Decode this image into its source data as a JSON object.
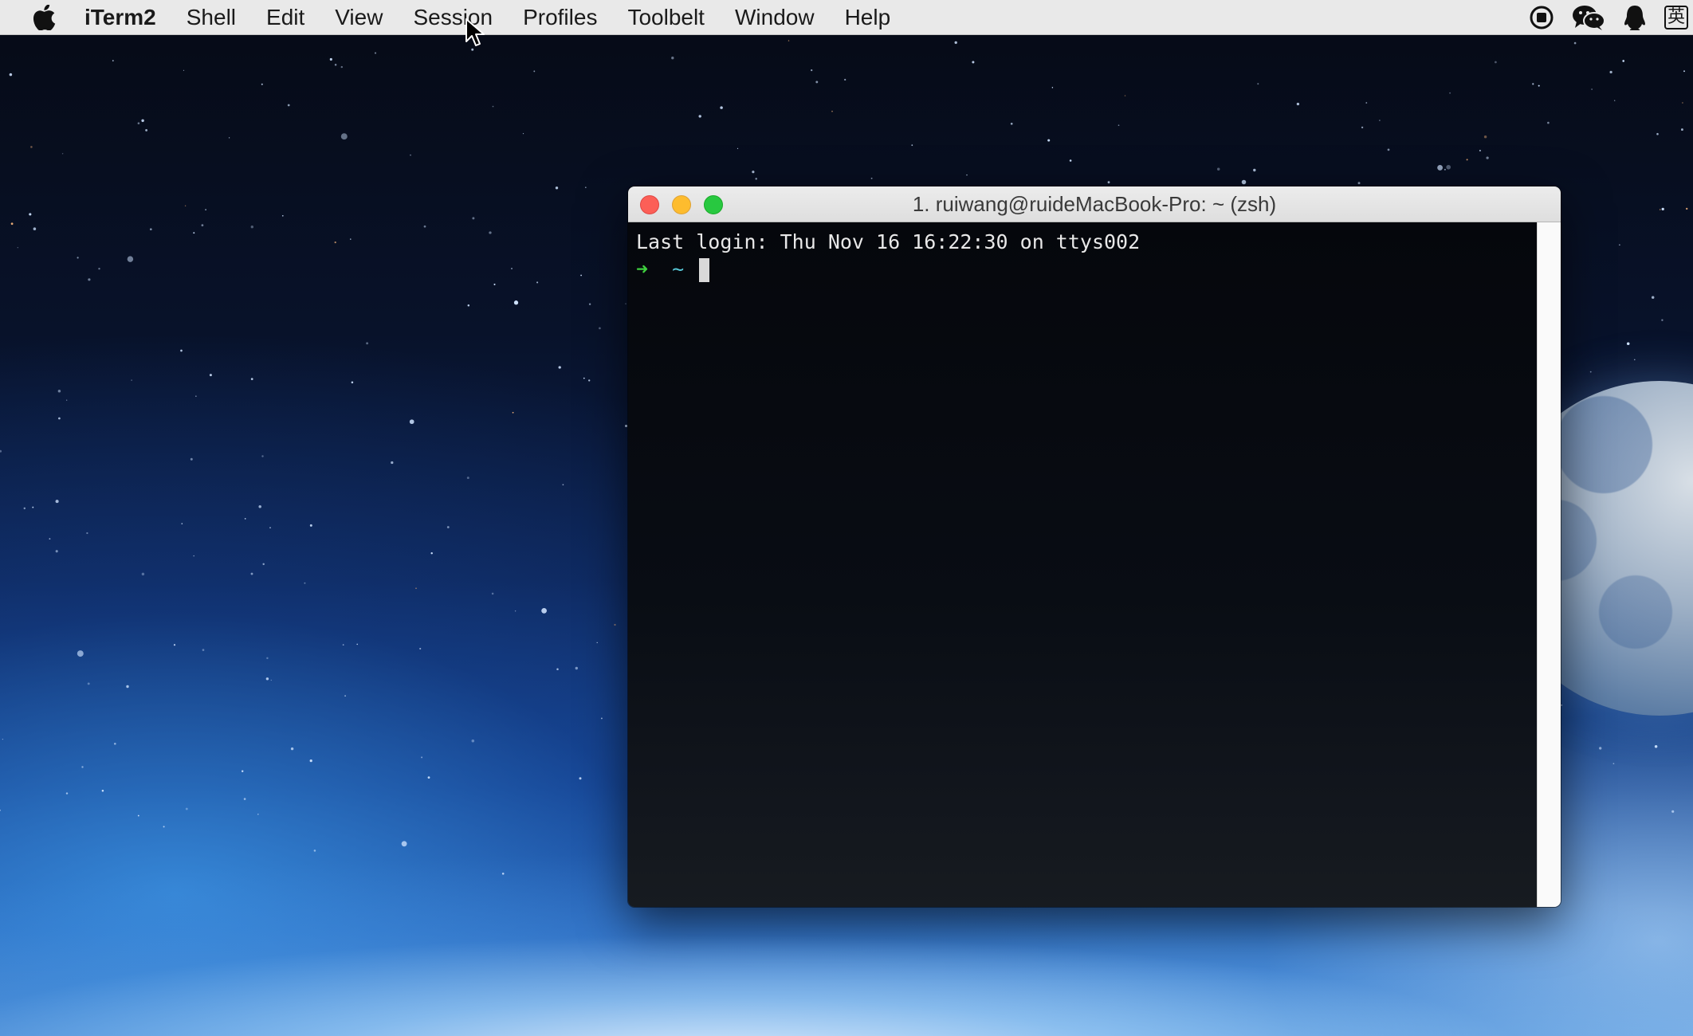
{
  "menubar": {
    "app_name": "iTerm2",
    "items": [
      "Shell",
      "Edit",
      "View",
      "Session",
      "Profiles",
      "Toolbelt",
      "Window",
      "Help"
    ],
    "status_icons": [
      "screen-record-icon",
      "wechat-icon",
      "qq-penguin-icon",
      "input-method-icon"
    ],
    "input_method_label": "英"
  },
  "terminal": {
    "window_title": "1. ruiwang@ruideMacBook-Pro: ~ (zsh)",
    "last_login": "Last login: Thu Nov 16 16:22:30 on ttys002",
    "prompt_arrow": "➜",
    "prompt_dir": "~"
  },
  "colors": {
    "prompt_arrow": "#3fd13f",
    "prompt_dir": "#57c7d6",
    "terminal_bg": "#05070c",
    "menubar_bg": "#e9e9e9"
  }
}
